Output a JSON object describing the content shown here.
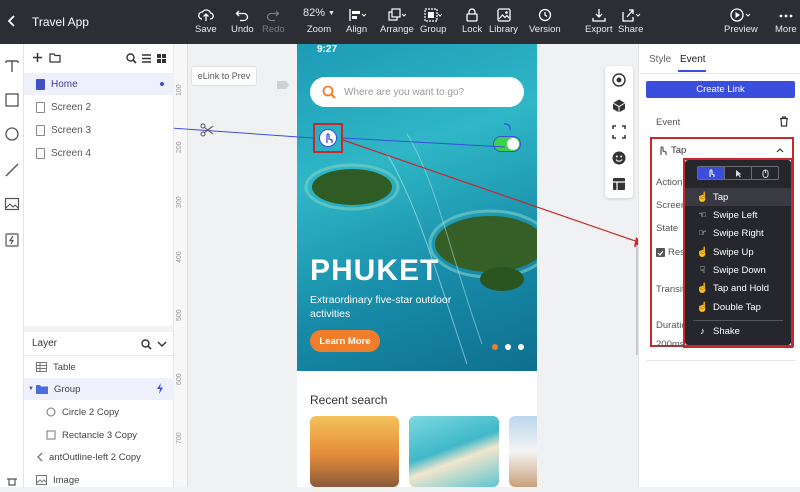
{
  "app": {
    "title": "Travel App"
  },
  "toolbar": {
    "save": "Save",
    "undo": "Undo",
    "redo": "Redo",
    "zoom": "82%",
    "zoom_label": "Zoom",
    "align": "Align",
    "arrange": "Arrange",
    "group": "Group",
    "lock": "Lock",
    "library": "Library",
    "version": "Version",
    "export": "Export",
    "share": "Share",
    "preview": "Preview",
    "more": "More"
  },
  "pages": {
    "items": [
      {
        "label": "Home",
        "active": true
      },
      {
        "label": "Screen 2"
      },
      {
        "label": "Screen 3"
      },
      {
        "label": "Screen 4"
      }
    ]
  },
  "layers": {
    "title": "Layer",
    "items": [
      {
        "label": "Table",
        "icon": "table-icon"
      },
      {
        "label": "Group",
        "icon": "folder-icon"
      },
      {
        "label": "Circle 2 Copy",
        "icon": "circle-icon"
      },
      {
        "label": "Rectancle 3 Copy",
        "icon": "square-icon"
      },
      {
        "label": "antOutline-left 2 Copy",
        "icon": "chevron-left-icon"
      },
      {
        "label": "Image",
        "icon": "image-icon"
      }
    ]
  },
  "canvas": {
    "link_badge": "eLink to Prev",
    "ruler": [
      "100",
      "200",
      "300",
      "400",
      "500",
      "600",
      "700"
    ],
    "phone": {
      "time": "9:27",
      "search_placeholder": "Where are you want to go?",
      "headline": "PHUKET",
      "subtitle": "Extraordinary five-star outdoor activities",
      "cta": "Learn More",
      "recent_title": "Recent search"
    }
  },
  "right_panel": {
    "tabs": [
      "Style",
      "Event"
    ],
    "create_link": "Create Link",
    "event_label": "Event",
    "trigger": "Tap",
    "action_label": "Action",
    "screen_label": "Screen",
    "state_label": "State",
    "reset_label": "Rese",
    "transition_label": "Transiti",
    "duration_label": "Duratio",
    "duration_value": "200ms"
  },
  "dropdown": {
    "items": [
      "Tap",
      "Swipe Left",
      "Swipe Right",
      "Swipe Up",
      "Swipe Down",
      "Tap and Hold",
      "Double Tap",
      "Shake"
    ]
  },
  "colors": {
    "accent": "#3b4ddc",
    "highlight": "#c9272c",
    "topbar": "#2d2e33",
    "cta": "#f07d2a"
  }
}
